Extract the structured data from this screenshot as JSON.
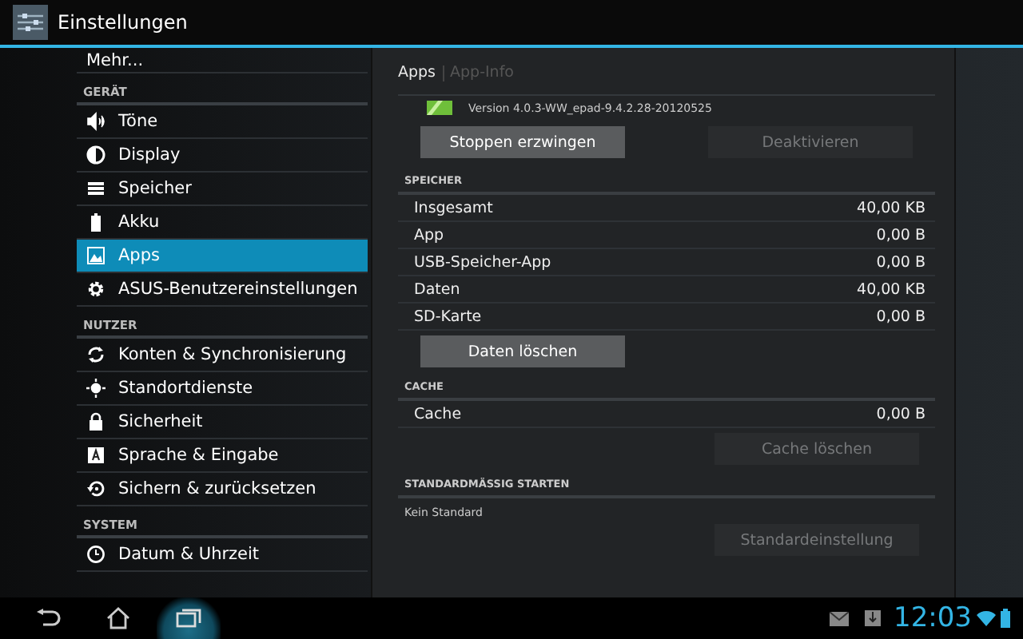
{
  "action_bar": {
    "title": "Einstellungen"
  },
  "sidebar": {
    "items": [
      {
        "kind": "item",
        "label": "Mehr...",
        "selected": false
      },
      {
        "kind": "header",
        "label": "GERÄT"
      },
      {
        "kind": "item",
        "label": "Töne",
        "selected": false
      },
      {
        "kind": "item",
        "label": "Display",
        "selected": false
      },
      {
        "kind": "item",
        "label": "Speicher",
        "selected": false
      },
      {
        "kind": "item",
        "label": "Akku",
        "selected": false
      },
      {
        "kind": "item",
        "label": "Apps",
        "selected": true
      },
      {
        "kind": "item",
        "label": "ASUS-Benutzereinstellungen",
        "selected": false
      },
      {
        "kind": "header",
        "label": "NUTZER"
      },
      {
        "kind": "item",
        "label": "Konten & Synchronisierung",
        "selected": false
      },
      {
        "kind": "item",
        "label": "Standortdienste",
        "selected": false
      },
      {
        "kind": "item",
        "label": "Sicherheit",
        "selected": false
      },
      {
        "kind": "item",
        "label": "Sprache & Eingabe",
        "selected": false
      },
      {
        "kind": "item",
        "label": "Sichern & zurücksetzen",
        "selected": false
      },
      {
        "kind": "header",
        "label": "SYSTEM"
      },
      {
        "kind": "item",
        "label": "Datum & Uhrzeit",
        "selected": false
      }
    ]
  },
  "detail": {
    "breadcrumbs": [
      {
        "label": "Apps",
        "selected": true
      },
      {
        "label": "App-Info",
        "selected": false
      }
    ],
    "version": "Version 4.0.3-WW_epad-9.4.2.28-20120525",
    "top_buttons": [
      {
        "label": "Stoppen erzwingen",
        "disabled": false
      },
      {
        "label": "Deaktivieren",
        "disabled": true
      }
    ],
    "sections": [
      {
        "title": "SPEICHER",
        "rows": [
          {
            "label": "Insgesamt",
            "value": "40,00 KB"
          },
          {
            "label": "App",
            "value": "0,00 B"
          },
          {
            "label": "USB-Speicher-App",
            "value": "0,00 B"
          },
          {
            "label": "Daten",
            "value": "40,00 KB"
          },
          {
            "label": "SD-Karte",
            "value": "0,00 B"
          }
        ],
        "button": {
          "label": "Daten löschen",
          "disabled": false
        }
      },
      {
        "title": "CACHE",
        "rows": [
          {
            "label": "Cache",
            "value": "0,00 B"
          }
        ],
        "button": {
          "label": "Cache löschen",
          "disabled": true
        }
      },
      {
        "title": "STANDARDMÄSSIG STARTEN",
        "note": "Kein Standard",
        "button": {
          "label": "Standardeinstellung",
          "disabled": true
        }
      }
    ]
  },
  "nav_bar": {
    "buttons": [
      {
        "kind": "back",
        "selected": false
      },
      {
        "kind": "home",
        "selected": false
      },
      {
        "kind": "recent",
        "selected": true
      }
    ],
    "time": "12:03"
  }
}
